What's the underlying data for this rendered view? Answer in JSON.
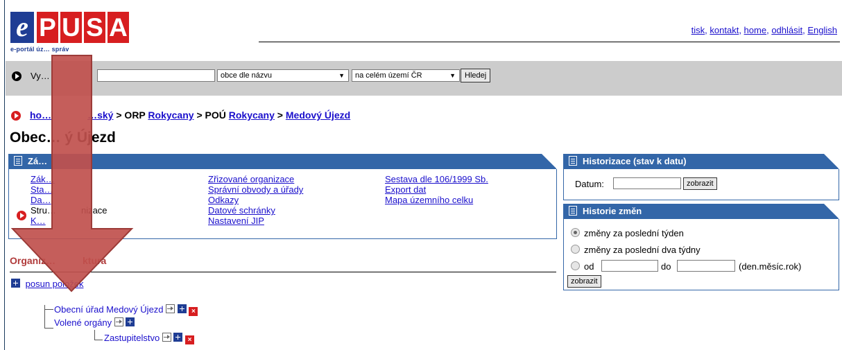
{
  "header": {
    "logo_letters": [
      "e",
      "P",
      "U",
      "S",
      "A"
    ],
    "logo_sub": "e-portál úz… správ",
    "links": [
      "tisk",
      "kontakt",
      "home",
      "odhlásit",
      "English"
    ]
  },
  "search": {
    "label": "Vy…",
    "input_value": "",
    "type_select": "obce dle názvu",
    "scope_select": "na celém území ČR",
    "button": "Hledej"
  },
  "breadcrumb": {
    "home": "ho…",
    "region": "…ský",
    "orp_prefix": " > ORP ",
    "orp": "Rokycany",
    "pou_prefix": " > POÚ ",
    "pou": "Rokycany",
    "sep": " > ",
    "current": "Medový Újezd"
  },
  "page_title": "Obec… ý Újezd",
  "main_panel": {
    "title": "Zá…",
    "col1": [
      "Zák…",
      "Sta…",
      "Da…",
      "Struktura organizace",
      "K…"
    ],
    "col1_active": "Stru…          nizace",
    "col2": [
      "Zřizované organizace",
      "Správní obvody a úřady",
      "Odkazy",
      "Datové schránky",
      "Nastavení JIP"
    ],
    "col3": [
      "Sestava dle 106/1999 Sb.",
      "Export dat",
      "Mapa územního celku"
    ]
  },
  "org": {
    "title": "Organiz…          ktura",
    "move_items": "posun položek",
    "tree": [
      {
        "label": "Obecní úřad Medový Újezd",
        "level": 1
      },
      {
        "label": "Volené orgány",
        "level": 1
      },
      {
        "label": "Zastupitelstvo",
        "level": 2
      }
    ]
  },
  "historizace": {
    "title": "Historizace (stav k datu)",
    "date_label": "Datum:",
    "date_value": "",
    "button": "zobrazit"
  },
  "historie": {
    "title": "Historie změn",
    "opt1": "změny za poslední týden",
    "opt2": "změny za poslední dva týdny",
    "od_label": "od",
    "do_label": "do",
    "format_hint": "(den.měsíc.rok)",
    "button": "zobrazit",
    "selected": "opt1"
  },
  "colors": {
    "panel_blue": "#3366a8",
    "logo_blue": "#1f3d94",
    "logo_red": "#d71e20",
    "arrow_red": "#c0504d",
    "link": "#1a0fcc"
  }
}
